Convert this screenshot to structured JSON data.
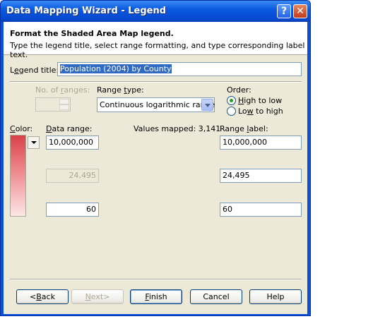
{
  "window": {
    "title": "Data Mapping Wizard - Legend",
    "help_glyph": "?",
    "close_glyph": "✕"
  },
  "header": {
    "title": "Format the Shaded Area Map legend.",
    "subtitle": "Type the legend title, select range formatting, and type corresponding label text."
  },
  "legend_title": {
    "label_pre": "L",
    "label_u": "e",
    "label_post": "gend title:",
    "value": "Population (2004) by County"
  },
  "ranges": {
    "no_of_ranges_label_pre": "No. of ",
    "no_of_ranges_label_u": "r",
    "no_of_ranges_label_post": "anges:",
    "range_type_label_pre": "Range ",
    "range_type_label_u": "t",
    "range_type_label_post": "ype:",
    "range_type_value": "Continuous logarithmic range",
    "order_label": "Order:",
    "order_options": [
      {
        "pre": "",
        "u": "H",
        "post": "igh to low",
        "checked": true
      },
      {
        "pre": "Lo",
        "u": "w",
        "post": " to high",
        "checked": false
      }
    ]
  },
  "columns": {
    "color_pre": "",
    "color_u": "C",
    "color_post": "olor:",
    "data_range_pre": "",
    "data_range_u": "D",
    "data_range_post": "ata range:",
    "values_mapped": "Values mapped: 3,141",
    "range_label_pre": "Range ",
    "range_label_u": "l",
    "range_label_post": "abel:"
  },
  "rows": [
    {
      "data": "10,000,000",
      "label": "10,000,000",
      "editable": true
    },
    {
      "data": "24,495",
      "label": "24,495",
      "editable": false
    },
    {
      "data": "60",
      "label": "60",
      "editable": true
    }
  ],
  "buttons": {
    "back_u": "B",
    "back_post": "ack",
    "next_pre": "",
    "next_u": "N",
    "next_post": "ext>",
    "finish_u": "F",
    "finish_post": "inish",
    "cancel": "Cancel",
    "help": "Help",
    "back_prefix": "<"
  },
  "colors": {
    "gradient_top": "#d9424a",
    "gradient_bottom": "#fde6e7",
    "titlebar": "#0a5ae0"
  }
}
